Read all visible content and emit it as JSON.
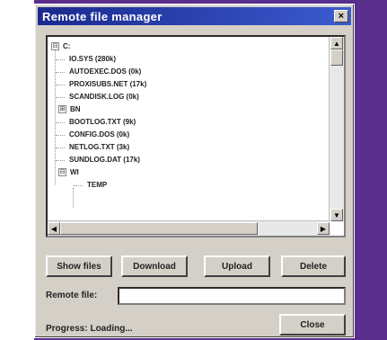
{
  "window": {
    "title": "Remote file manager",
    "close_glyph": "×"
  },
  "tree": {
    "root": {
      "toggle": "⊟",
      "label": "C:"
    },
    "items": [
      {
        "label": "IO.SYS (280k)",
        "type": "file"
      },
      {
        "label": "AUTOEXEC.DOS (0k)",
        "type": "file"
      },
      {
        "label": "PROXISUBS.NET (17k)",
        "type": "file"
      },
      {
        "label": "SCANDISK.LOG (0k)",
        "type": "file"
      },
      {
        "label": "BN",
        "type": "folder",
        "toggle": "⊞"
      },
      {
        "label": "BOOTLOG.TXT (9k)",
        "type": "file"
      },
      {
        "label": "CONFIG.DOS (0k)",
        "type": "file"
      },
      {
        "label": "NETLOG.TXT (3k)",
        "type": "file"
      },
      {
        "label": "SUNDLOG.DAT (17k)",
        "type": "file"
      },
      {
        "label": "WI",
        "type": "folder",
        "toggle": "⊟"
      },
      {
        "label": "TEMP",
        "type": "subfolder"
      }
    ]
  },
  "buttons": {
    "show_files": "Show files",
    "download": "Download",
    "upload": "Upload",
    "delete": "Delete",
    "close": "Close"
  },
  "remote_file": {
    "label": "Remote file:",
    "value": ""
  },
  "status": {
    "text": "Progress: Loading..."
  },
  "colors": {
    "background": "#5a2e8c",
    "titlebar": "#1a2a8e",
    "window": "#d4d0c8"
  }
}
